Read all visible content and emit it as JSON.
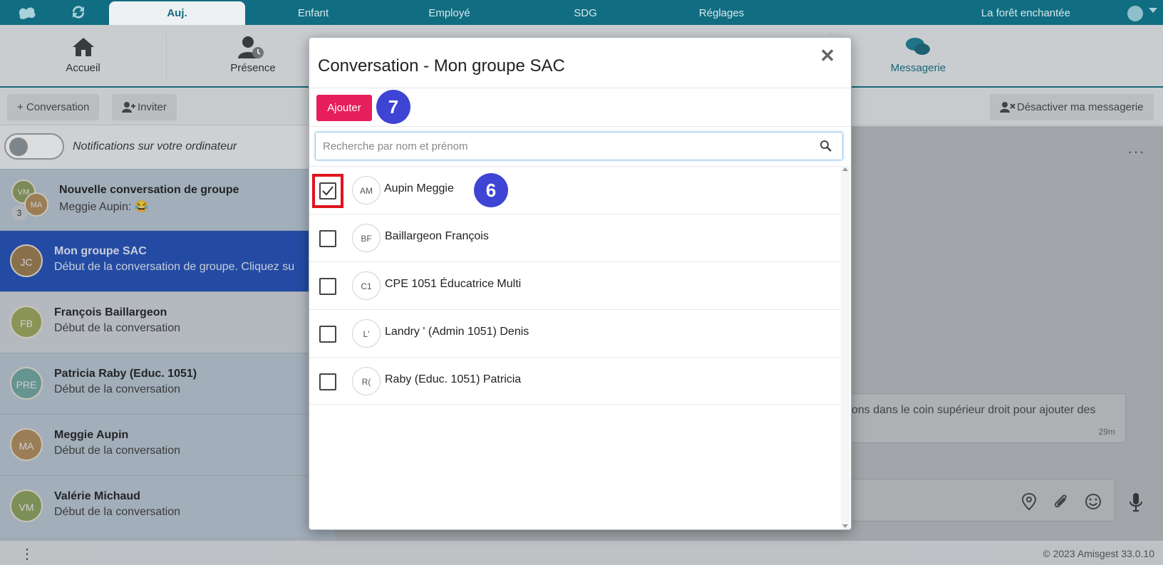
{
  "topbar": {
    "tabs": [
      {
        "label": "Auj."
      },
      {
        "label": "Enfant"
      },
      {
        "label": "Employé"
      },
      {
        "label": "SDG"
      },
      {
        "label": "Réglages"
      }
    ],
    "site_name": "La forêt enchantée"
  },
  "nav": {
    "accueil": "Accueil",
    "presence": "Présence",
    "messagerie": "Messagerie"
  },
  "toolbar": {
    "conversation": "+ Conversation",
    "inviter": "Inviter",
    "desactiver": "Désactiver ma messagerie"
  },
  "notifications": {
    "label": "Notifications sur votre ordinateur"
  },
  "conversations": [
    {
      "initials": "VM",
      "initials2": "MA",
      "count": "3",
      "title": "Nouvelle conversation de groupe",
      "preview": "Meggie Aupin: 😂"
    },
    {
      "initials": "JC",
      "title": "Mon groupe SAC",
      "preview": "Début de la conversation de groupe. Cliquez su"
    },
    {
      "initials": "FB",
      "title": "François Baillargeon",
      "preview": "Début de la conversation"
    },
    {
      "initials": "PRE",
      "title": "Patricia Raby (Educ. 1051)",
      "preview": "Début de la conversation"
    },
    {
      "initials": "MA",
      "title": "Meggie Aupin",
      "preview": "Début de la conversation"
    },
    {
      "initials": "VM",
      "title": "Valérie Michaud",
      "preview": "Début de la conversation"
    }
  ],
  "chat": {
    "message": "tions dans le coin supérieur droit pour ajouter des",
    "time": "29m"
  },
  "footer": {
    "copyright": "© 2023 Amisgest 33.0.10"
  },
  "modal": {
    "title": "Conversation - Mon groupe SAC",
    "add_button": "Ajouter",
    "step_add": "7",
    "step_select": "6",
    "search_placeholder": "Recherche par nom et prénom",
    "members": [
      {
        "initials": "AM",
        "name": "Aupin Meggie",
        "checked": true
      },
      {
        "initials": "BF",
        "name": "Baillargeon François",
        "checked": false
      },
      {
        "initials": "C1",
        "name": "CPE 1051 Éducatrice Multi",
        "checked": false
      },
      {
        "initials": "L'",
        "name": "Landry ' (Admin 1051) Denis",
        "checked": false
      },
      {
        "initials": "R(",
        "name": "Raby (Educ. 1051) Patricia",
        "checked": false
      }
    ]
  },
  "colors": {
    "teal": "#116d81",
    "accent": "#e61f5a",
    "step": "#3e44d3",
    "highlight": "#e0141e",
    "selected": "#1f4db8"
  }
}
